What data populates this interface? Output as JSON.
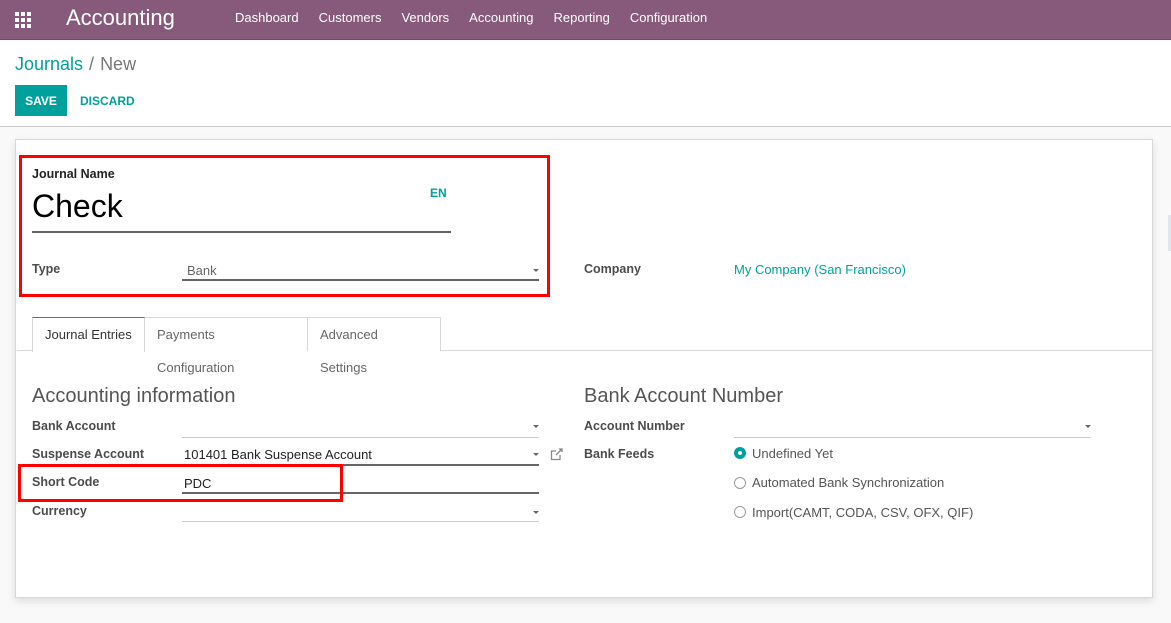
{
  "navbar": {
    "app_title": "Accounting",
    "apps_icon": "apps-grid-icon",
    "menu": [
      "Dashboard",
      "Customers",
      "Vendors",
      "Accounting",
      "Reporting",
      "Configuration"
    ]
  },
  "breadcrumb": {
    "parent": "Journals",
    "separator": "/",
    "current": "New"
  },
  "buttons": {
    "save": "SAVE",
    "discard": "DISCARD"
  },
  "form": {
    "journal_name_label": "Journal Name",
    "journal_name_value": "Check",
    "language_button": "EN",
    "type_label": "Type",
    "type_value": "Bank",
    "company_label": "Company",
    "company_value": "My Company (San Francisco)"
  },
  "tabs": [
    {
      "label": "Journal Entries",
      "active": true
    },
    {
      "label": "Payments Configuration",
      "active": false
    },
    {
      "label": "Advanced Settings",
      "active": false
    }
  ],
  "accounting_info": {
    "title": "Accounting information",
    "bank_account_label": "Bank Account",
    "bank_account_value": "",
    "suspense_account_label": "Suspense Account",
    "suspense_account_value": "101401 Bank Suspense Account",
    "short_code_label": "Short Code",
    "short_code_value": "PDC",
    "currency_label": "Currency",
    "currency_value": ""
  },
  "bank_account_number": {
    "title": "Bank Account Number",
    "account_number_label": "Account Number",
    "account_number_value": "",
    "bank_feeds_label": "Bank Feeds",
    "bank_feeds_options": [
      {
        "label": "Undefined Yet",
        "checked": true
      },
      {
        "label": "Automated Bank Synchronization",
        "checked": false
      },
      {
        "label": "Import(CAMT, CODA, CSV, OFX, QIF)",
        "checked": false
      }
    ]
  },
  "colors": {
    "navbar": "#875a7b",
    "accent": "#00a09d",
    "highlight": "#ff0000"
  }
}
